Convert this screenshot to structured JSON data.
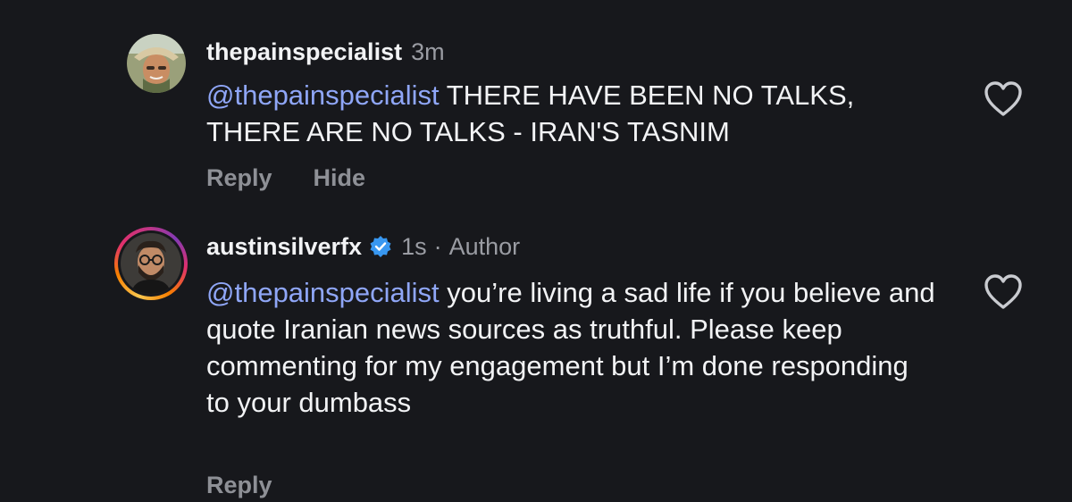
{
  "comments": [
    {
      "username": "thepainspecialist",
      "timestamp": "3m",
      "verified": false,
      "author_label": "",
      "mention": "@thepainspecialist",
      "text": " THERE HAVE BEEN NO TALKS, THERE ARE NO TALKS - IRAN'S TASNIM",
      "actions": [
        "Reply",
        "Hide"
      ],
      "avatar": "profile-photo-man-in-hat"
    },
    {
      "username": "austinsilverfx",
      "timestamp": "1s",
      "verified": true,
      "author_label": "Author",
      "separator": "·",
      "mention": "@thepainspecialist",
      "text": " you’re living a sad life if you believe and quote Iranian news sources as truthful. Please keep commenting for my engagement but I’m done responding to your dumbass",
      "actions": [
        "Reply"
      ],
      "avatar": "profile-photo-man-with-glasses-story-ring"
    }
  ],
  "colors": {
    "background": "#17181c",
    "text": "#f2f3f5",
    "secondary": "#9a9ca3",
    "mention": "#8fa6f7",
    "verified": "#3897f0"
  },
  "icons": {
    "like": "heart-outline-icon",
    "verified": "verified-badge-icon"
  }
}
